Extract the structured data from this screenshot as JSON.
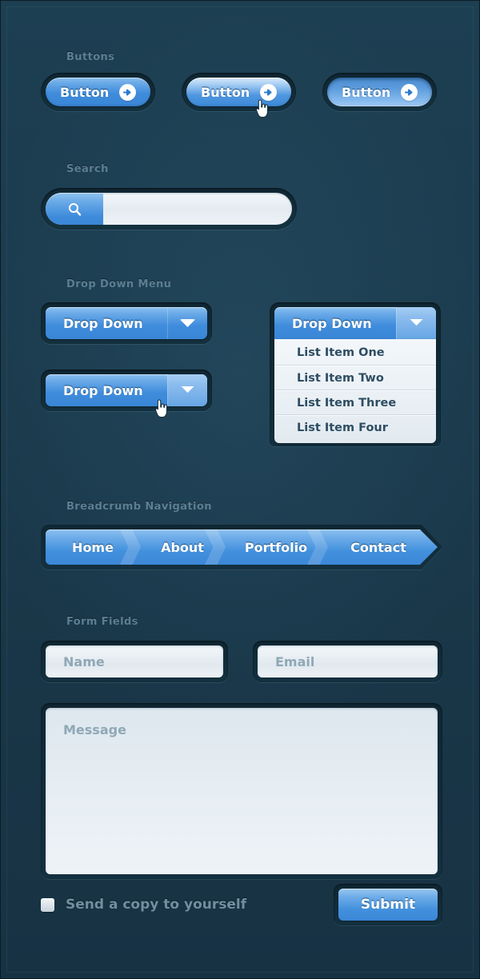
{
  "theme": {
    "background": "#1b3a4c",
    "frame_border": "#0a1c26",
    "accent_blue": "#3f8cdc",
    "accent_blue_light": "#8dc0ee",
    "label_color": "#5b7f93",
    "field_text": "#3f5b6d"
  },
  "sections": {
    "buttons_label": "Buttons",
    "search_label": "Search",
    "dropdown_label": "Drop Down Menu",
    "breadcrumb_label": "Breadcrumb Navigation",
    "form_label": "Form Fields"
  },
  "buttons": [
    {
      "label": "Button",
      "state": "normal",
      "icon": "arrow-right-icon"
    },
    {
      "label": "Button",
      "state": "hover",
      "icon": "arrow-right-icon"
    },
    {
      "label": "Button",
      "state": "active",
      "icon": "arrow-right-icon"
    }
  ],
  "search": {
    "icon": "magnifier-icon",
    "value": "",
    "placeholder": ""
  },
  "dropdowns": [
    {
      "label": "Drop Down",
      "state": "normal",
      "icon": "chevron-down-icon"
    },
    {
      "label": "Drop Down",
      "state": "hover",
      "icon": "chevron-down-icon"
    },
    {
      "label": "Drop Down",
      "state": "open",
      "icon": "chevron-down-icon"
    }
  ],
  "dropdown_items": [
    "List Item One",
    "List Item Two",
    "List Item Three",
    "List Item Four"
  ],
  "breadcrumb": [
    "Home",
    "About",
    "Portfolio",
    "Contact"
  ],
  "form": {
    "name_placeholder": "Name",
    "name_value": "",
    "email_placeholder": "Email",
    "email_value": "",
    "message_placeholder": "Message",
    "message_value": "",
    "checkbox_label": "Send a copy to yourself",
    "checkbox_checked": false,
    "submit_label": "Submit"
  },
  "cursors": [
    {
      "name": "pointer-hand-cursor",
      "on": "button-hover"
    },
    {
      "name": "pointer-hand-cursor",
      "on": "dropdown-hover"
    }
  ]
}
